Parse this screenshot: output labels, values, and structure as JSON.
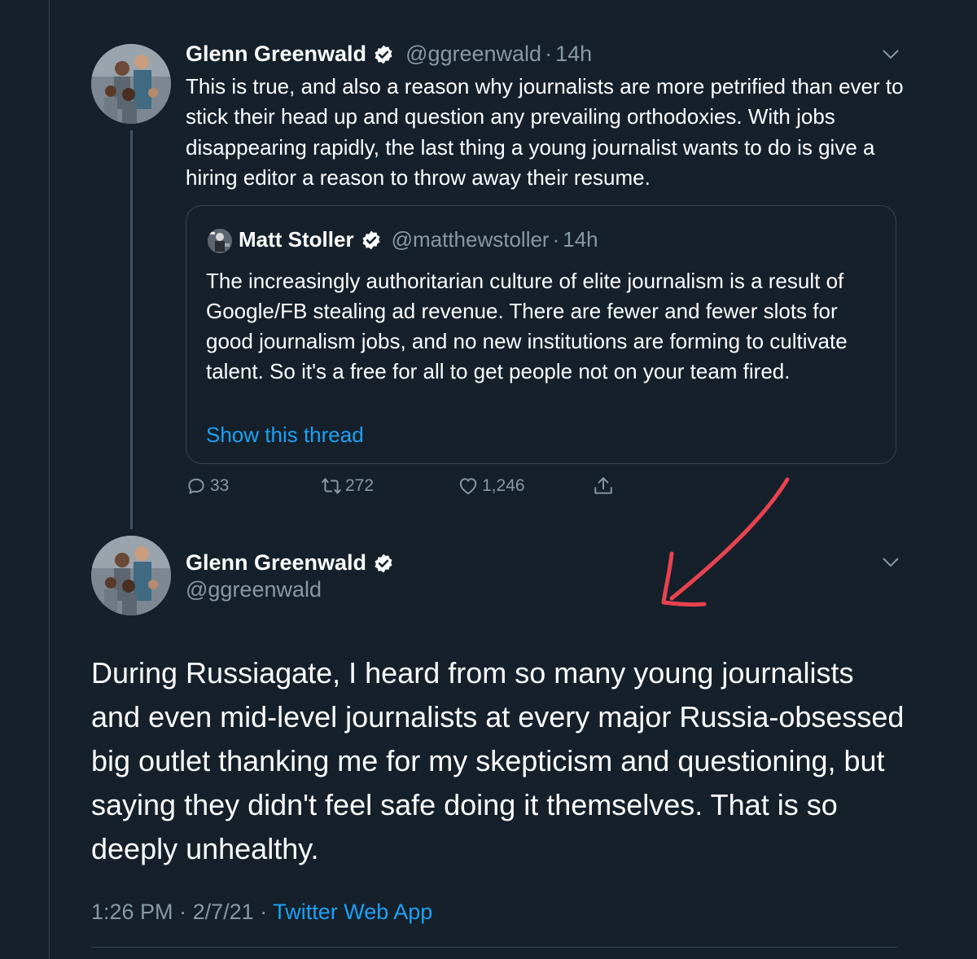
{
  "reply_tweet": {
    "author_name": "Glenn Greenwald",
    "handle": "@ggreenwald",
    "separator": "·",
    "time": "14h",
    "text": "This is true, and also a reason why journalists are more petrified than ever to stick their head up and question any prevailing orthodoxies. With jobs disappearing rapidly, the last thing a young journalist wants to do is give a hiring editor a reason to throw away their resume.",
    "quote": {
      "author_name": "Matt Stoller",
      "handle": "@matthewstoller",
      "separator": "·",
      "time": "14h",
      "text": "The increasingly authoritarian culture of elite journalism is a result of Google/FB stealing ad revenue. There are fewer and fewer slots for good journalism jobs, and no new institutions are forming to cultivate talent. So it's a free for all to get people not on your team fired.",
      "show_thread": "Show this thread"
    },
    "actions": {
      "replies": "33",
      "retweets": "272",
      "likes": "1,246"
    }
  },
  "main_tweet": {
    "author_name": "Glenn Greenwald",
    "handle": "@ggreenwald",
    "text": "During Russiagate, I heard from so many young journalists and even mid-level journalists at every major Russia-obsessed big outlet thanking me for my skepticism and questioning, but saying they didn't feel safe doing it themselves. That is so deeply unhealthy.",
    "time": "1:26 PM",
    "separator": "·",
    "date": "2/7/21",
    "separator2": "·",
    "source": "Twitter Web App"
  },
  "icons": {
    "verified": "verified-badge-icon",
    "caret": "chevron-down-icon",
    "reply": "reply-icon",
    "retweet": "retweet-icon",
    "like": "heart-icon",
    "share": "share-icon"
  },
  "colors": {
    "background": "#15202b",
    "text_primary": "#ffffff",
    "text_secondary": "#8899a6",
    "link": "#1da1f2",
    "border": "#38444d",
    "annotation_arrow": "#e8434f"
  }
}
